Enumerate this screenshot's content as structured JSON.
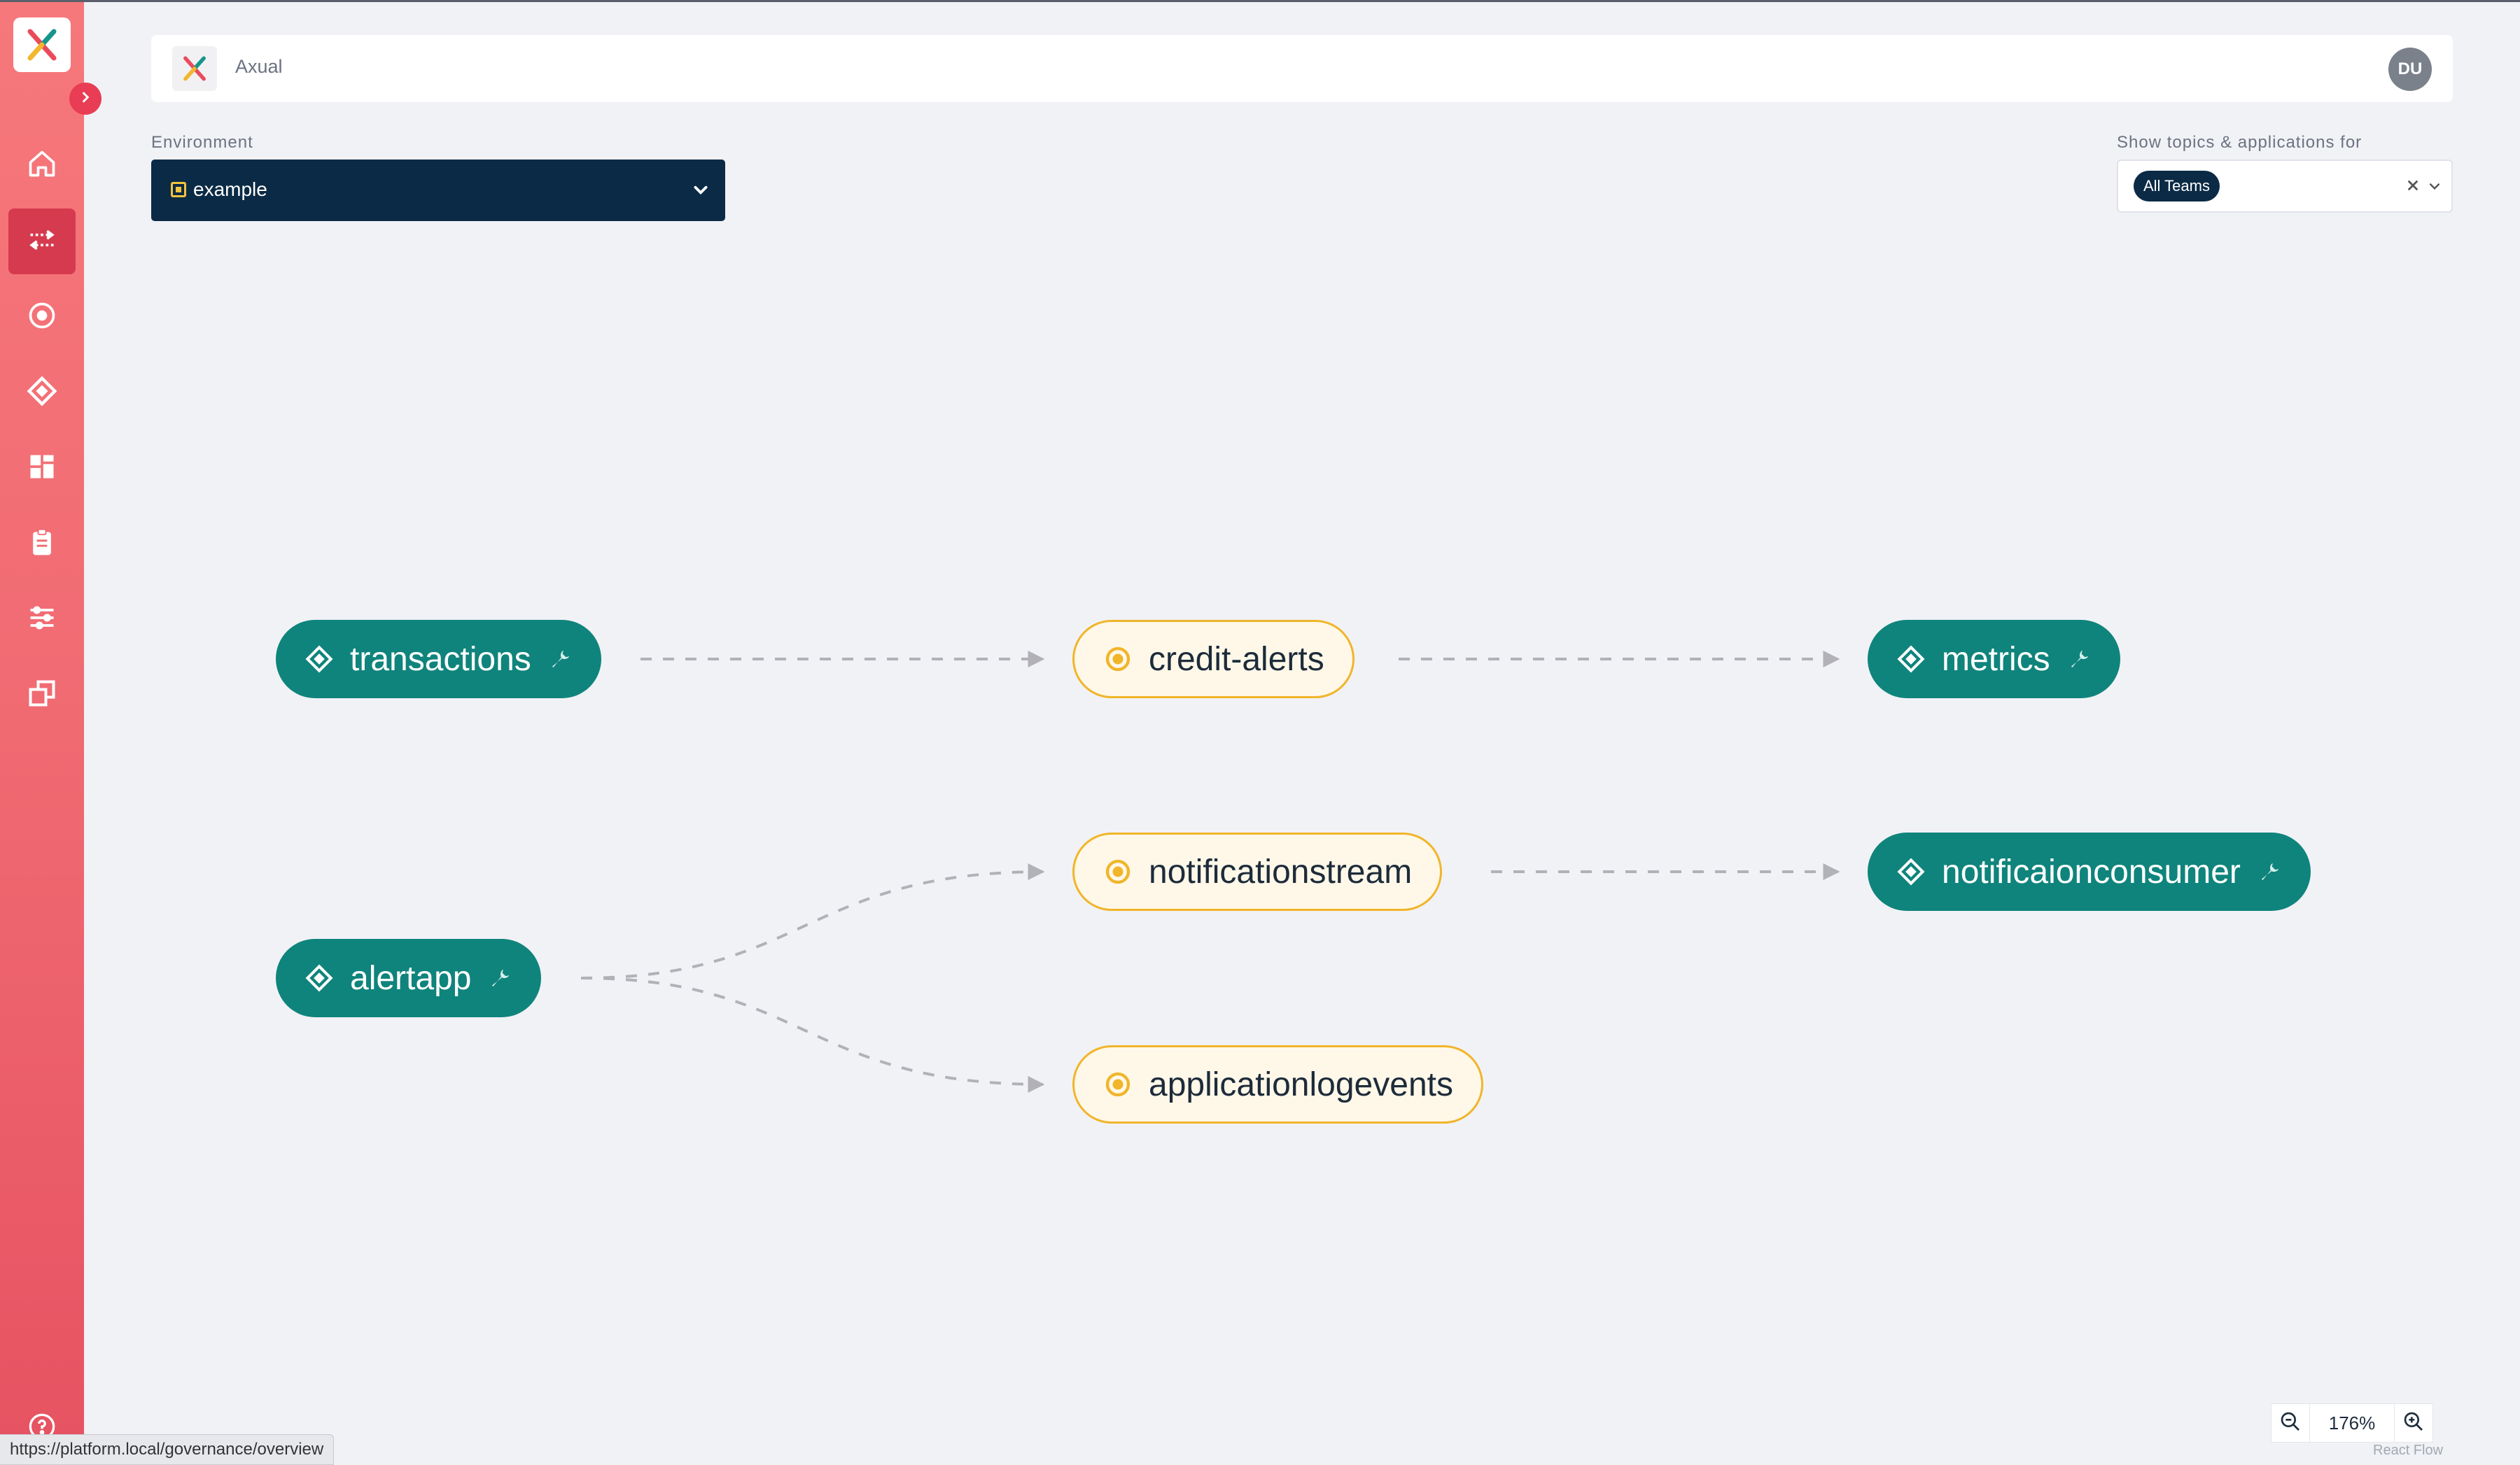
{
  "header": {
    "title": "Axual",
    "avatar_initials": "DU"
  },
  "sidebar": {
    "items": [
      {
        "icon": "home-icon",
        "active": false
      },
      {
        "icon": "stream-overview-icon",
        "active": true
      },
      {
        "icon": "topic-icon",
        "active": false
      },
      {
        "icon": "application-icon",
        "active": false
      },
      {
        "icon": "dashboard-icon",
        "active": false
      },
      {
        "icon": "clipboard-icon",
        "active": false
      },
      {
        "icon": "settings-sliders-icon",
        "active": false
      },
      {
        "icon": "windows-icon",
        "active": false
      }
    ],
    "help_icon": "help-icon"
  },
  "environment": {
    "label": "Environment",
    "value": "example"
  },
  "teams_filter": {
    "label": "Show topics & applications for",
    "chip": "All Teams"
  },
  "graph": {
    "nodes": [
      {
        "id": "transactions",
        "label": "transactions",
        "kind": "application"
      },
      {
        "id": "credit-alerts",
        "label": "credit-alerts",
        "kind": "topic"
      },
      {
        "id": "metrics",
        "label": "metrics",
        "kind": "application"
      },
      {
        "id": "notificationstream",
        "label": "notificationstream",
        "kind": "topic"
      },
      {
        "id": "notificaionconsumer",
        "label": "notificaionconsumer",
        "kind": "application"
      },
      {
        "id": "alertapp",
        "label": "alertapp",
        "kind": "application"
      },
      {
        "id": "applicationlogevents",
        "label": "applicationlogevents",
        "kind": "topic"
      }
    ],
    "edges": [
      {
        "from": "transactions",
        "to": "credit-alerts"
      },
      {
        "from": "credit-alerts",
        "to": "metrics"
      },
      {
        "from": "notificationstream",
        "to": "notificaionconsumer"
      },
      {
        "from": "alertapp",
        "to": "notificationstream"
      },
      {
        "from": "alertapp",
        "to": "applicationlogevents"
      }
    ]
  },
  "zoom": {
    "value": "176%",
    "attribution": "React Flow"
  },
  "status_url": "https://platform.local/governance/overview",
  "colors": {
    "sidebar": "#f06a72",
    "application_node": "#0f847c",
    "topic_node_fill": "#fff8e8",
    "topic_node_border": "#f1b52a",
    "environment_select": "#0b2a45"
  }
}
